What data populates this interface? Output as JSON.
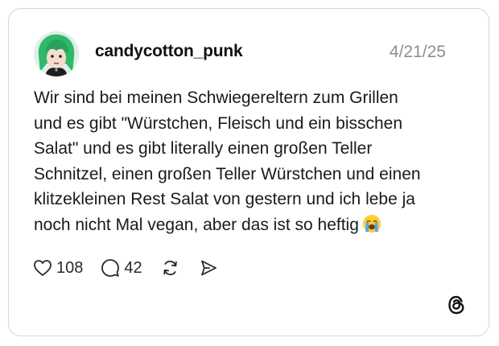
{
  "post": {
    "username": "candycotton_punk",
    "date": "4/21/25",
    "text": "Wir sind bei meinen Schwiegereltern zum Grillen\nund es gibt \"Würstchen, Fleisch und ein bisschen\nSalat\" und es gibt literally einen großen Teller\nSchnitzel, einen großen Teller Würstchen und einen\nklitzekleinen Rest Salat von gestern und ich lebe ja\nnoch nicht Mal vegan, aber das ist so heftig",
    "emoji_icon": "loudly-crying-face-emoji"
  },
  "actions": {
    "likes": "108",
    "comments": "42",
    "like_icon": "heart-icon",
    "comment_icon": "speech-bubble-icon",
    "repost_icon": "repost-icon",
    "share_icon": "send-icon"
  },
  "brand": {
    "logo_icon": "threads-logo-icon"
  },
  "colors": {
    "text": "#1a1a1a",
    "muted": "#8e8e8e",
    "border": "#d6d6d6",
    "avatar_hair": "#2fb86a"
  }
}
